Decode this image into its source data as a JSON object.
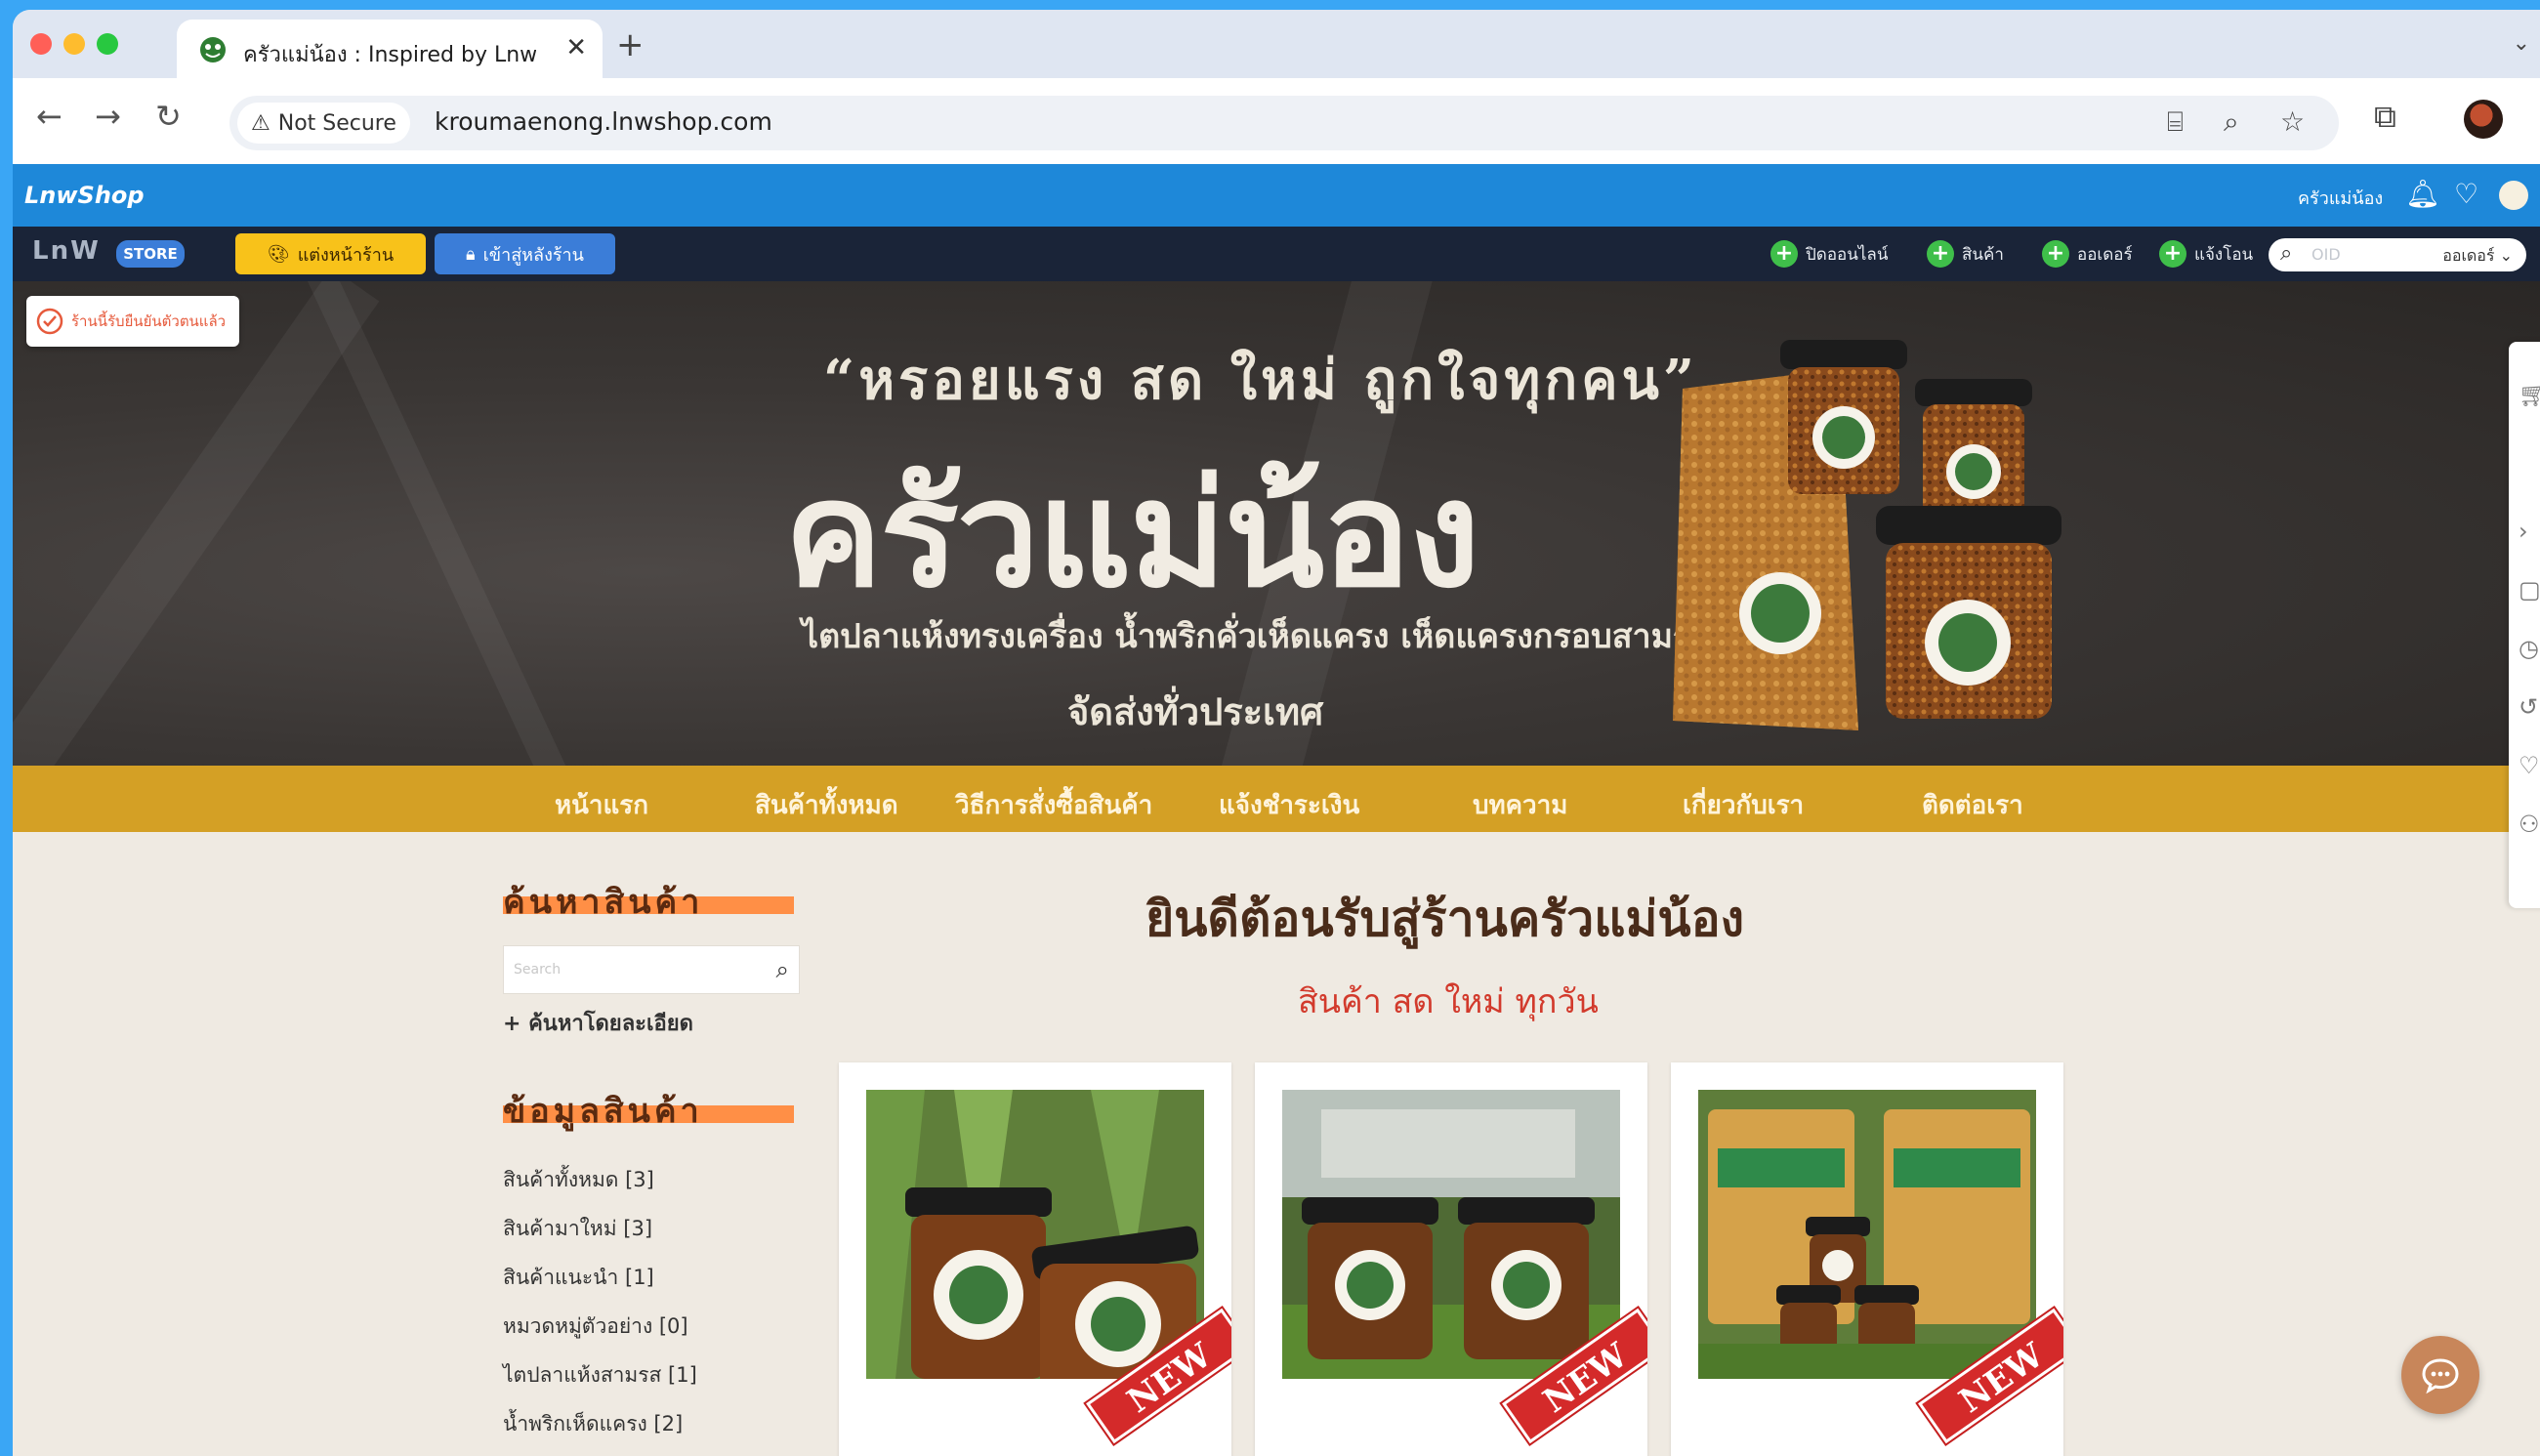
{
  "browser": {
    "tab": {
      "title": "ครัวแม่น้อง : Inspired by LnwShop",
      "close": "✕"
    },
    "new_tab": "+",
    "tab_menu": "⌄",
    "security_label": "Not Secure",
    "url": "kroumaenong.lnwshop.com",
    "traffic_colors": {
      "close": "#ff5f57",
      "minimize": "#febc2e",
      "maximize": "#28c840"
    }
  },
  "lnw_bar": {
    "logo": "LnwShop",
    "shop_name": "ครัวแม่น้อง"
  },
  "admin_bar": {
    "logo": "LnW",
    "store_badge": "STORE",
    "decorate_label": "แต่งหน้าร้าน",
    "backend_label": "เข้าสู่หลังร้าน",
    "actions": [
      {
        "label": "ปิดออนไลน์"
      },
      {
        "label": "สินค้า"
      },
      {
        "label": "ออเดอร์"
      },
      {
        "label": "แจ้งโอน"
      }
    ],
    "search_placeholder": "OID",
    "search_scope": "ออเดอร์"
  },
  "review_chip": {
    "label": "ร้านนี้รับยืนยันตัวตนแล้ว"
  },
  "hero": {
    "slogan": "“หรอยแรง สด ใหม่ ถูกใจทุกคน”",
    "brand": "ครัวแม่น้อง",
    "tagline": "ไตปลาแห้งทรงเครื่อง  น้ำพริกคั่วเห็ดแครง เห็ดแครงกรอบสามรส",
    "shipping": "จัดส่งทั่วประเทศ"
  },
  "nav": {
    "items": [
      "หน้าแรก",
      "สินค้าทั้งหมด",
      "วิธีการสั่งซื้อสินค้า",
      "แจ้งชำระเงิน",
      "บทความ",
      "เกี่ยวกับเรา",
      "ติดต่อเรา"
    ]
  },
  "sidebar": {
    "search_heading": "ค้นหาสินค้า",
    "search_placeholder": "Search",
    "advanced_search": "+ ค้นหาโดยละเอียด",
    "info_heading": "ข้อมูลสินค้า",
    "categories": [
      "สินค้าทั้งหมด [3]",
      "สินค้ามาใหม่ [3]",
      "สินค้าแนะนำ [1]",
      "หมวดหมู่ตัวอย่าง [0]",
      "ไตปลาแห้งสามรส [1]",
      "น้ำพริกเห็ดแครง [2]"
    ]
  },
  "main": {
    "welcome_title": "ยินดีต้อนรับสู่ร้านครัวแม่น้อง",
    "welcome_subtitle": "สินค้า สด ใหม่ ทุกวัน",
    "products": [
      {
        "badge": "NEW"
      },
      {
        "badge": "NEW"
      },
      {
        "badge": "NEW"
      }
    ]
  },
  "colors": {
    "lnw_blue": "#1e88d9",
    "admin_dark": "#1a2438",
    "nav_gold": "#d4a025",
    "heading_orange": "#ff8a3d",
    "accent_red": "#d23a2c"
  }
}
